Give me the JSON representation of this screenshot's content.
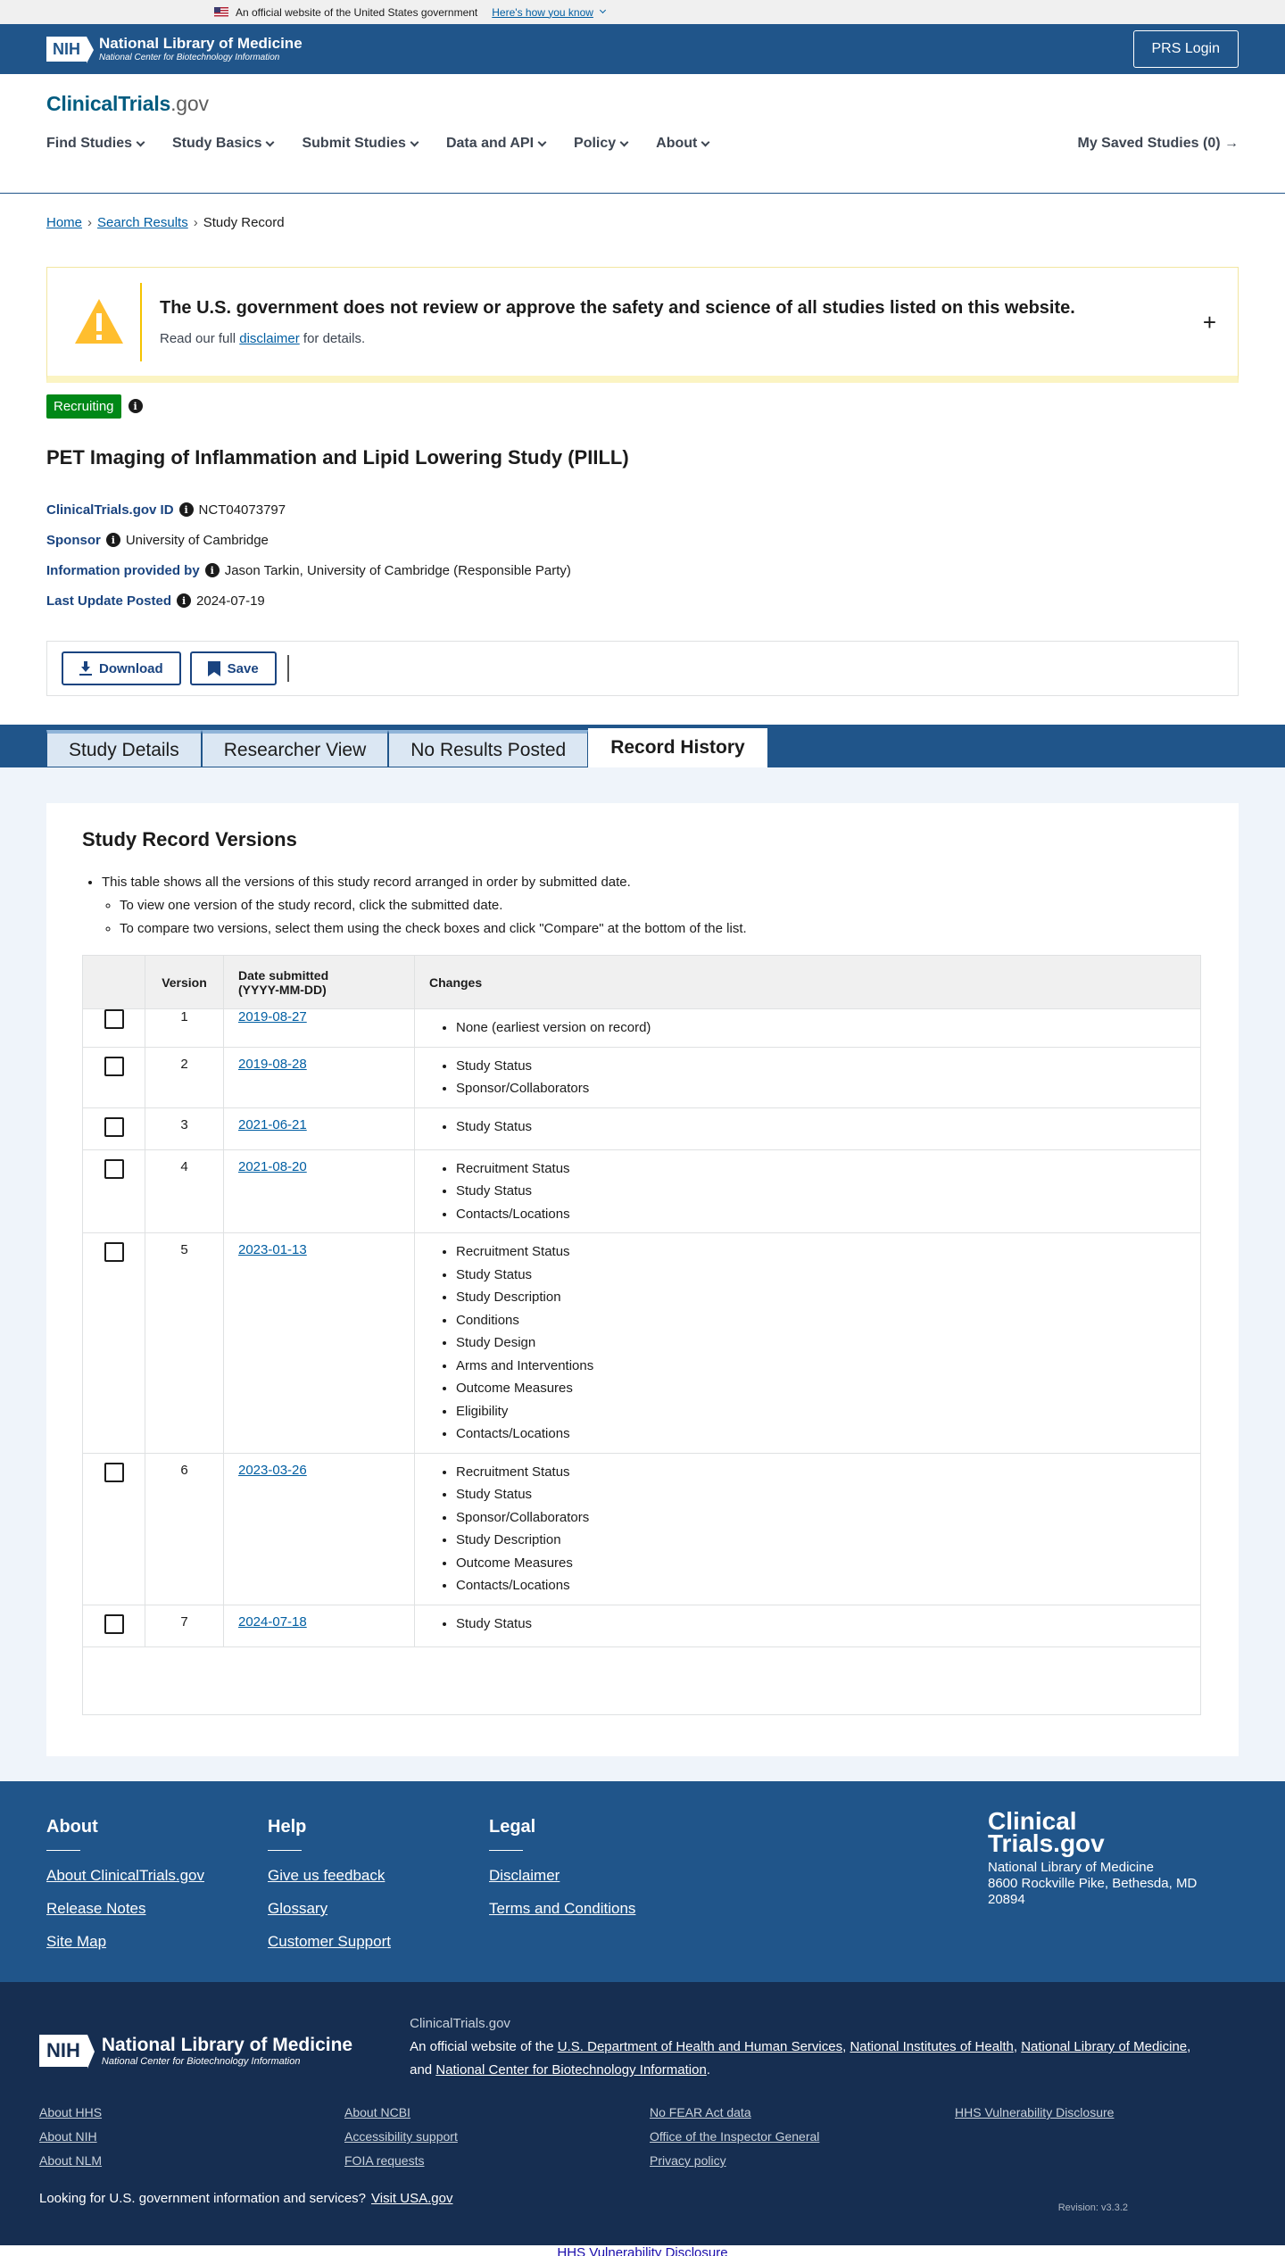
{
  "gov_banner": {
    "text": "An official website of the United States government",
    "link": "Here's how you know"
  },
  "nih_header": {
    "logo_abbr": "NIH",
    "title": "National Library of Medicine",
    "subtitle": "National Center for Biotechnology Information",
    "prs_login": "PRS Login"
  },
  "site": {
    "logo_main": "ClinicalTrials",
    "logo_suffix": ".gov"
  },
  "nav": {
    "items": [
      "Find Studies",
      "Study Basics",
      "Submit Studies",
      "Data and API",
      "Policy",
      "About"
    ],
    "saved": "My Saved Studies (0)"
  },
  "breadcrumb": [
    "Home",
    "Search Results",
    "Study Record"
  ],
  "alert": {
    "title": "The U.S. government does not review or approve the safety and science of all studies listed on this website.",
    "text_before": "Read our full",
    "link": "disclaimer",
    "text_after": "for details.",
    "toggle": "+"
  },
  "study": {
    "status": "Recruiting",
    "title": "PET Imaging of Inflammation and Lipid Lowering Study (PIILL)",
    "meta": [
      {
        "label": "ClinicalTrials.gov ID",
        "value": "NCT04073797"
      },
      {
        "label": "Sponsor",
        "value": "University of Cambridge"
      },
      {
        "label": "Information provided by",
        "value": "Jason Tarkin, University of Cambridge (Responsible Party)"
      },
      {
        "label": "Last Update Posted",
        "value": "2024-07-19"
      }
    ]
  },
  "actions": {
    "download": "Download",
    "save": "Save"
  },
  "tabs": [
    "Study Details",
    "Researcher View",
    "No Results Posted",
    "Record History"
  ],
  "versions": {
    "heading": "Study Record Versions",
    "intro": "This table shows all the versions of this study record arranged in order by submitted date.",
    "intro_sub": [
      "To view one version of the study record, click the submitted date.",
      "To compare two versions, select them using the check boxes and click \"Compare\" at the bottom of the list."
    ],
    "columns": {
      "version": "Version",
      "date_line1": "Date submitted",
      "date_line2": "(YYYY-MM-DD)",
      "changes": "Changes"
    },
    "rows": [
      {
        "version": "1",
        "date": "2019-08-27",
        "changes": [
          "None (earliest version on record)"
        ]
      },
      {
        "version": "2",
        "date": "2019-08-28",
        "changes": [
          "Study Status",
          "Sponsor/Collaborators"
        ]
      },
      {
        "version": "3",
        "date": "2021-06-21",
        "changes": [
          "Study Status"
        ]
      },
      {
        "version": "4",
        "date": "2021-08-20",
        "changes": [
          "Recruitment Status",
          "Study Status",
          "Contacts/Locations"
        ]
      },
      {
        "version": "5",
        "date": "2023-01-13",
        "changes": [
          "Recruitment Status",
          "Study Status",
          "Study Description",
          "Conditions",
          "Study Design",
          "Arms and Interventions",
          "Outcome Measures",
          "Eligibility",
          "Contacts/Locations"
        ]
      },
      {
        "version": "6",
        "date": "2023-03-26",
        "changes": [
          "Recruitment Status",
          "Study Status",
          "Sponsor/Collaborators",
          "Study Description",
          "Outcome Measures",
          "Contacts/Locations"
        ]
      },
      {
        "version": "7",
        "date": "2024-07-18",
        "changes": [
          "Study Status"
        ]
      }
    ]
  },
  "footer": {
    "cols": [
      {
        "title": "About",
        "links": [
          "About ClinicalTrials.gov",
          "Release Notes",
          "Site Map"
        ]
      },
      {
        "title": "Help",
        "links": [
          "Give us feedback",
          "Glossary",
          "Customer Support"
        ]
      },
      {
        "title": "Legal",
        "links": [
          "Disclaimer",
          "Terms and Conditions"
        ]
      }
    ],
    "logo_line1": "Clinical",
    "logo_line2": "Trials.gov",
    "address": [
      "National Library of Medicine",
      "8600 Rockville Pike, Bethesda, MD",
      "20894"
    ]
  },
  "nlm_footer": {
    "site": "ClinicalTrials.gov",
    "desc_prefix": "An official website of the",
    "orgs": [
      "U.S. Department of Health and Human Services",
      "National Institutes of Health",
      "National Library of Medicine",
      "National Center for Biotechnology Information"
    ],
    "links": [
      "About HHS",
      "About NCBI",
      "No FEAR Act data",
      "HHS Vulnerability Disclosure",
      "About NIH",
      "Accessibility support",
      "Office of the Inspector General",
      "",
      "About NLM",
      "FOIA requests",
      "Privacy policy",
      ""
    ],
    "usa_text": "Looking for U.S. government information and services?",
    "usa_link": "Visit USA.gov",
    "revision": "Revision: v3.3.2"
  },
  "bottom_link": "HHS Vulnerability Disclosure",
  "colors": {
    "nih_blue": "#20558a",
    "navy": "#162e51",
    "link": "#005ea2",
    "badge_green": "#008817",
    "warning_yellow": "#ffbe2e"
  }
}
